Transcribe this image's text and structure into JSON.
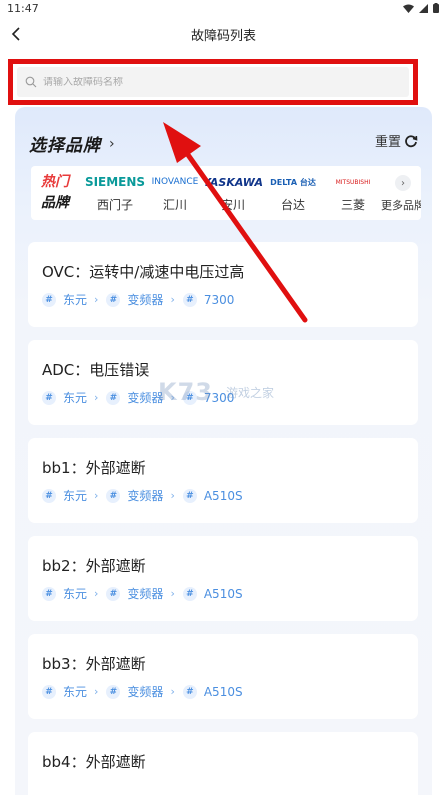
{
  "status": {
    "time": "11:47"
  },
  "nav": {
    "title": "故障码列表"
  },
  "search": {
    "placeholder": "请输入故障码名称"
  },
  "brand_section": {
    "title": "选择品牌",
    "arrow": "›",
    "reset_label": "重置",
    "hot_top": "热门",
    "hot_bottom": "品牌",
    "brands": [
      {
        "logo": "SIEMENS",
        "name": "西门子",
        "color": "#0a9a9a"
      },
      {
        "logo": "INOVANCE",
        "name": "汇川",
        "color": "#1a6fd0"
      },
      {
        "logo": "YASKAWA",
        "name": "安川",
        "color": "#10358a"
      },
      {
        "logo": "DELTA 台达",
        "name": "台达",
        "color": "#1a5fb4"
      },
      {
        "logo": "MITSUBISHI",
        "name": "三菱",
        "color": "#d81b1b"
      }
    ],
    "more_label": "更多品牌"
  },
  "faults": [
    {
      "title": "OVC：运转中/减速中电压过高",
      "tags": [
        "东元",
        "变频器",
        "7300"
      ]
    },
    {
      "title": "ADC：电压错误",
      "tags": [
        "东元",
        "变频器",
        "7300"
      ]
    },
    {
      "title": "bb1：外部遮断",
      "tags": [
        "东元",
        "变频器",
        "A510S"
      ]
    },
    {
      "title": "bb2：外部遮断",
      "tags": [
        "东元",
        "变频器",
        "A510S"
      ]
    },
    {
      "title": "bb3：外部遮断",
      "tags": [
        "东元",
        "变频器",
        "A510S"
      ]
    },
    {
      "title": "bb4：外部遮断",
      "tags": []
    }
  ],
  "watermark": {
    "main": "K73",
    "sub": "游戏之家"
  },
  "colors": {
    "accent": "#4b8fe0",
    "highlight": "#e01010",
    "hot": "#e83b3b"
  }
}
